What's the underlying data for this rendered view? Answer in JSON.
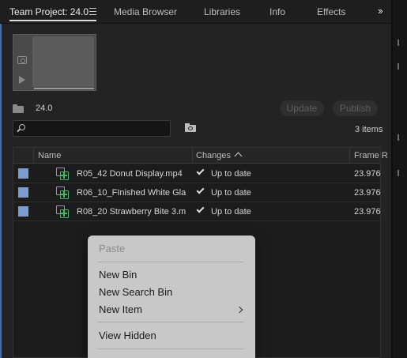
{
  "tabs": [
    {
      "label": "Team Project: 24.0"
    },
    {
      "label": "Media Browser"
    },
    {
      "label": "Libraries"
    },
    {
      "label": "Info"
    },
    {
      "label": "Effects"
    }
  ],
  "project": {
    "name": "24.0",
    "update_label": "Update",
    "publish_label": "Publish",
    "item_count": "3 items"
  },
  "search": {
    "value": "",
    "placeholder": ""
  },
  "table": {
    "columns": [
      "Name",
      "Changes",
      "Frame R"
    ],
    "rows": [
      {
        "name": "R05_42 Donut Display.mp4",
        "status": "Up to date",
        "fps": "23.976"
      },
      {
        "name": "R06_10_FInished White Gla",
        "status": "Up to date",
        "fps": "23.976"
      },
      {
        "name": "R08_20 Strawberry Bite 3.m",
        "status": "Up to date",
        "fps": "23.976"
      }
    ]
  },
  "context_menu": {
    "items": [
      {
        "label": "Paste",
        "disabled": true
      },
      {
        "label": "New Bin",
        "disabled": false
      },
      {
        "label": "New Search Bin",
        "disabled": false
      },
      {
        "label": "New Item",
        "disabled": false,
        "submenu": true
      },
      {
        "label": "View Hidden",
        "disabled": false
      }
    ]
  },
  "colors": {
    "panel_focus": "#3a6fb0",
    "label_swatch": "#7d9ccf",
    "clip_video": "#a38bd1",
    "clip_audio": "#48b46a",
    "menu_bg": "#c8c8c8"
  },
  "icons": [
    "tab-menu-icon",
    "overflow-chevron-icon",
    "camera-icon",
    "play-icon",
    "folder-icon",
    "search-icon",
    "new-bin-icon",
    "sort-ascending-icon",
    "clip-icon",
    "checkmark-icon",
    "submenu-chevron-icon"
  ]
}
